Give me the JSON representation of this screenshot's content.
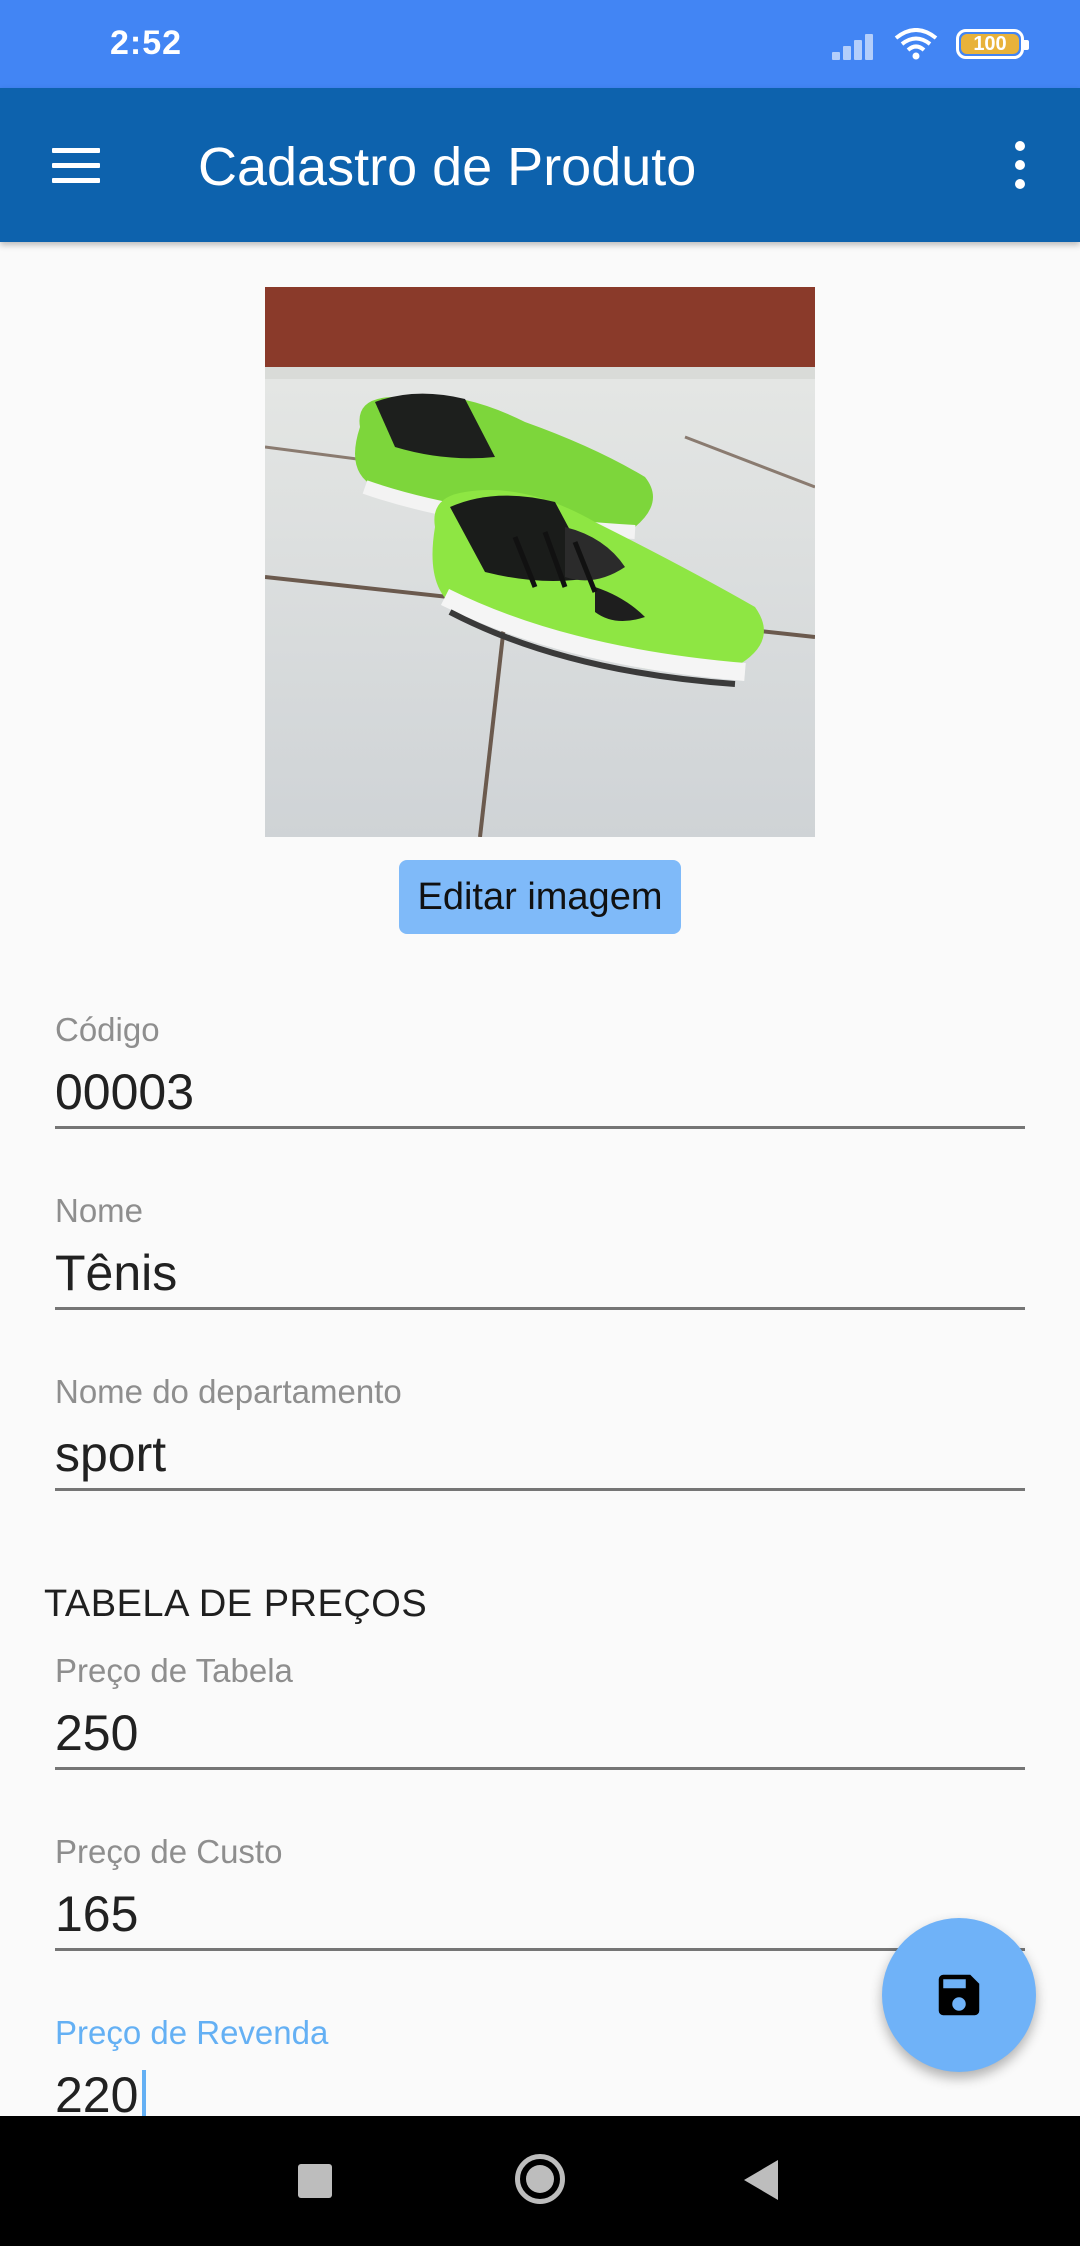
{
  "status_bar": {
    "time": "2:52",
    "battery": "100"
  },
  "app_bar": {
    "title": "Cadastro de Produto"
  },
  "product": {
    "edit_image_label": "Editar imagem"
  },
  "fields": {
    "codigo": {
      "label": "Código",
      "value": "00003"
    },
    "nome": {
      "label": "Nome",
      "value": "Tênis"
    },
    "departamento": {
      "label": "Nome do departamento",
      "value": "sport"
    }
  },
  "price_section": {
    "title": "TABELA DE PREÇOS",
    "preco_tabela": {
      "label": "Preço de Tabela",
      "value": "250"
    },
    "preco_custo": {
      "label": "Preço de Custo",
      "value": "165"
    },
    "preco_revenda": {
      "label": "Preço de Revenda",
      "value": "220"
    }
  },
  "icons": {
    "menu": "menu-icon",
    "overflow": "more-vert-icon",
    "save": "save-icon",
    "wifi": "wifi-icon",
    "signal": "signal-icon",
    "battery": "battery-icon"
  },
  "colors": {
    "status_bar": "#4285f4",
    "app_bar": "#0d62ad",
    "accent": "#64b0f4",
    "button": "#7fbaf9"
  }
}
